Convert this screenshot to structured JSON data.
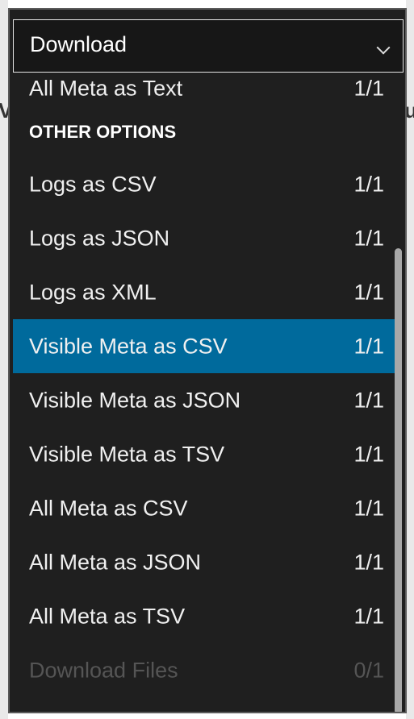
{
  "background": {
    "left_glyph": "V",
    "right_glyph": "u"
  },
  "select": {
    "label": "Download"
  },
  "menu": {
    "items_top": [
      {
        "label": "All Meta as Text",
        "count": "1/1"
      }
    ],
    "section_header": "OTHER OPTIONS",
    "items": [
      {
        "label": "Logs as CSV",
        "count": "1/1"
      },
      {
        "label": "Logs as JSON",
        "count": "1/1"
      },
      {
        "label": "Logs as XML",
        "count": "1/1"
      },
      {
        "label": "Visible Meta as CSV",
        "count": "1/1",
        "selected": true
      },
      {
        "label": "Visible Meta as JSON",
        "count": "1/1"
      },
      {
        "label": "Visible Meta as TSV",
        "count": "1/1"
      },
      {
        "label": "All Meta as CSV",
        "count": "1/1"
      },
      {
        "label": "All Meta as JSON",
        "count": "1/1"
      },
      {
        "label": "All Meta as TSV",
        "count": "1/1"
      },
      {
        "label": "Download Files",
        "count": "0/1",
        "disabled": true
      }
    ]
  },
  "colors": {
    "selected_bg": "#006a9c",
    "menu_bg": "#1f1f1f",
    "disabled_text": "#555555"
  }
}
